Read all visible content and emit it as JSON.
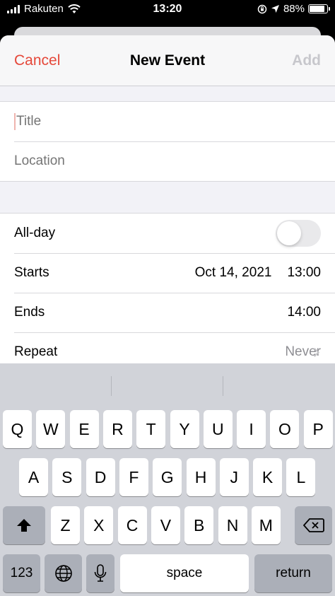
{
  "status": {
    "carrier": "Rakuten",
    "time": "13:20",
    "battery": "88%",
    "battery_level": 0.88
  },
  "nav": {
    "cancel": "Cancel",
    "title": "New Event",
    "add": "Add"
  },
  "fields": {
    "title_placeholder": "Title",
    "location_placeholder": "Location"
  },
  "rows": {
    "allday": "All-day",
    "starts_label": "Starts",
    "starts_date": "Oct 14, 2021",
    "starts_time": "13:00",
    "ends_label": "Ends",
    "ends_time": "14:00",
    "repeat_label": "Repeat",
    "repeat_value": "Never"
  },
  "keyboard": {
    "row1": [
      "Q",
      "W",
      "E",
      "R",
      "T",
      "Y",
      "U",
      "I",
      "O",
      "P"
    ],
    "row2": [
      "A",
      "S",
      "D",
      "F",
      "G",
      "H",
      "J",
      "K",
      "L"
    ],
    "row3": [
      "Z",
      "X",
      "C",
      "V",
      "B",
      "N",
      "M"
    ],
    "numbers": "123",
    "space": "space",
    "return": "return"
  },
  "colors": {
    "accent": "#e5483a",
    "disabled": "#c7c7cc"
  }
}
